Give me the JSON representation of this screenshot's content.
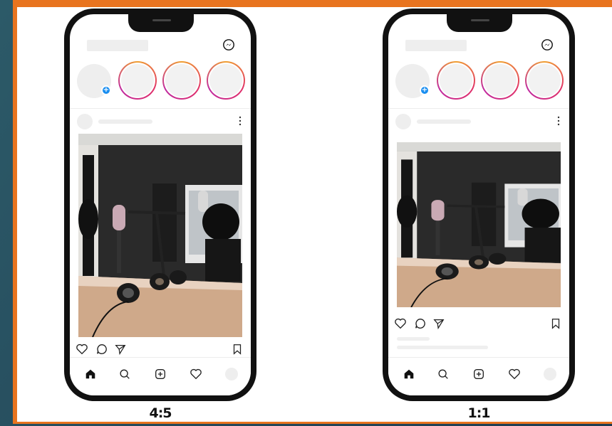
{
  "mockups": [
    {
      "ratio_label": "4:5"
    },
    {
      "ratio_label": "1:1"
    }
  ],
  "icons": {
    "header": "messenger-icon",
    "stories_add": "plus-icon",
    "post_menu": "more-vertical-icon",
    "actions": [
      "heart-icon",
      "comment-icon",
      "share-icon",
      "bookmark-icon"
    ],
    "tabbar": [
      "home-icon",
      "search-icon",
      "add-post-icon",
      "activity-heart-icon",
      "profile-avatar"
    ]
  },
  "colors": {
    "frame": "#e8741f",
    "story_ring_start": "#f0a030",
    "story_ring_end": "#c02aa0",
    "add_story": "#1a8ef0"
  }
}
